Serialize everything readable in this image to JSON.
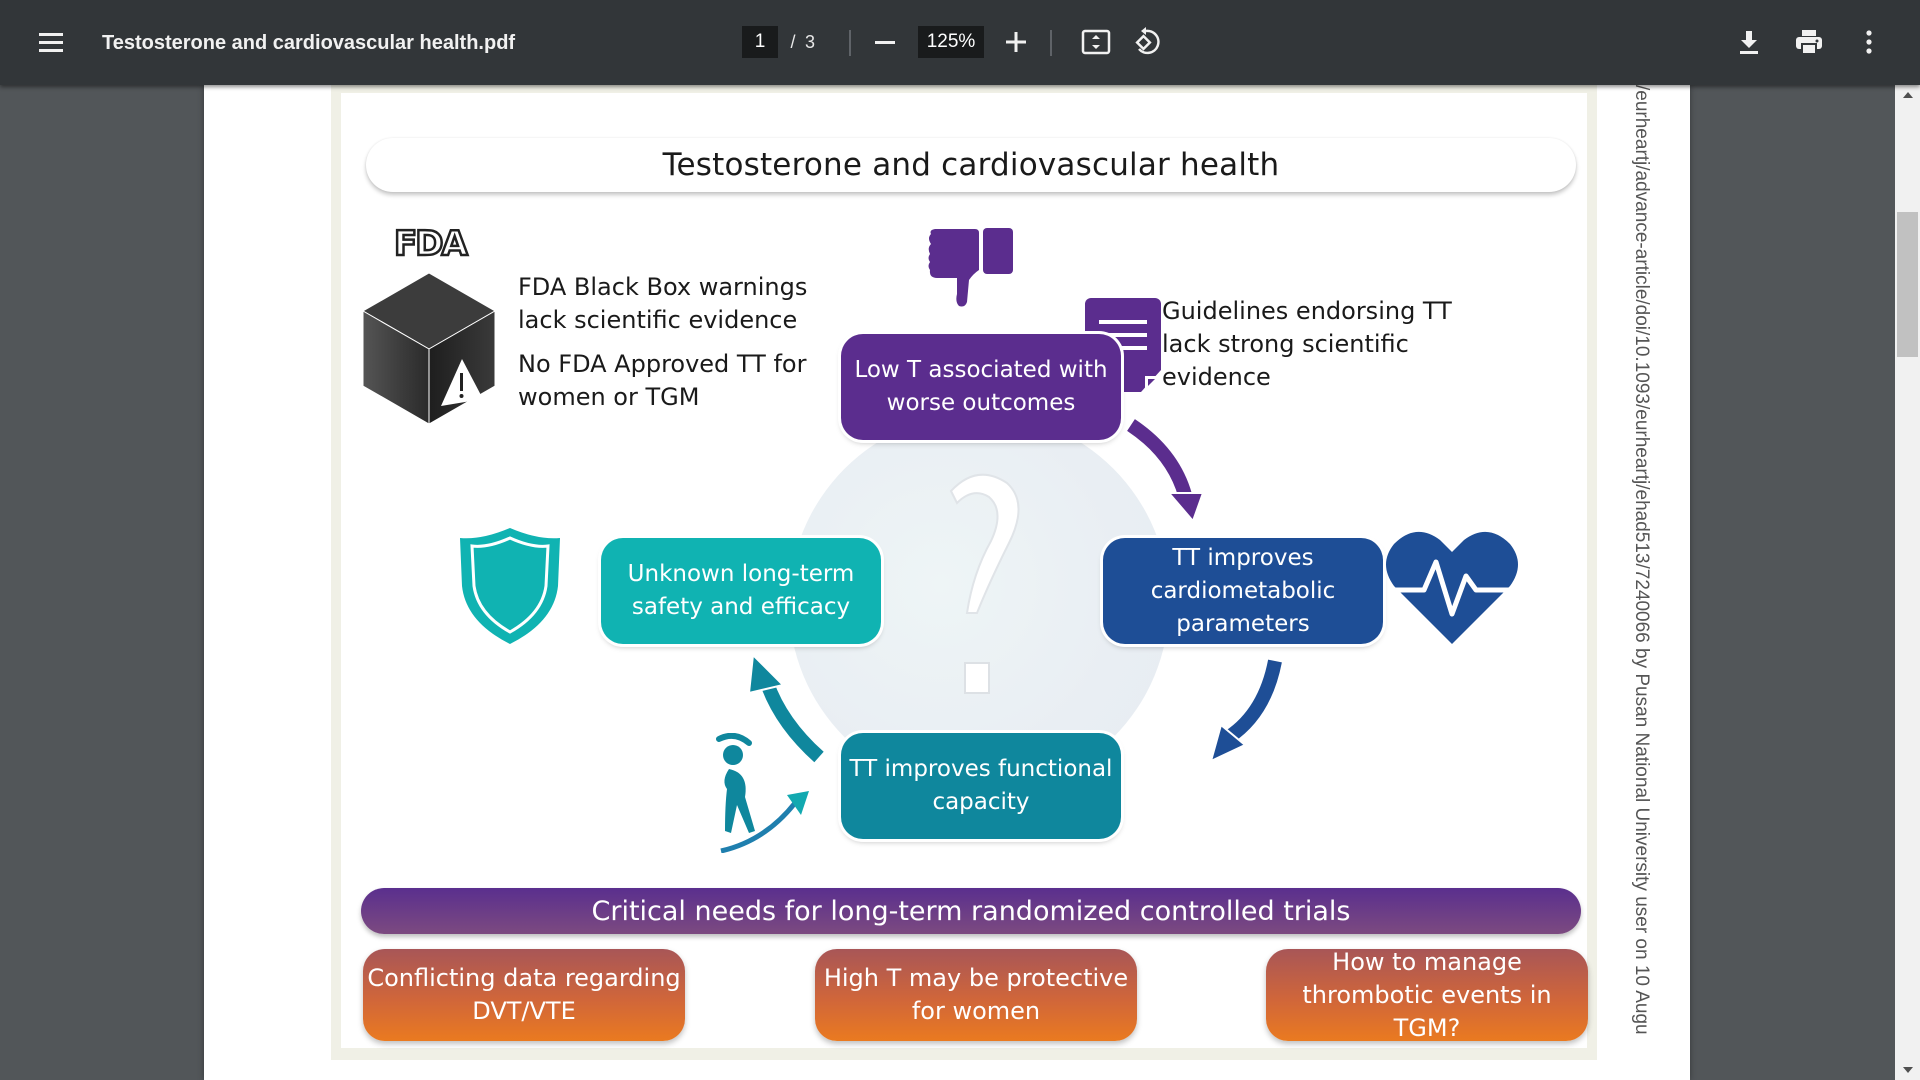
{
  "toolbar": {
    "title": "Testosterone and cardiovascular health.pdf",
    "current_page": "1",
    "page_separator": "/",
    "total_pages": "3",
    "zoom_level": "125%",
    "icons": {
      "menu": "hamburger-menu-icon",
      "zoom_out": "minus-icon",
      "zoom_in": "plus-icon",
      "fit": "fit-to-page-icon",
      "rotate": "rotate-counterclockwise-icon",
      "download": "download-icon",
      "print": "print-icon",
      "more": "more-vertical-icon"
    }
  },
  "infographic": {
    "title": "Testosterone and cardiovascular health",
    "fda_logo": "FDA",
    "fda_warning": "FDA Black Box warnings lack scientific evidence",
    "fda_no_approved": "No FDA Approved TT for women or TGM",
    "guidelines": "Guidelines endorsing TT lack strong scientific evidence",
    "cycle": {
      "low_t": "Low T associated with worse outcomes",
      "cardiometabolic": "TT improves cardiometabolic parameters",
      "functional": "TT improves functional capacity",
      "unknown": "Unknown long-term safety and efficacy",
      "center_symbol": "?"
    },
    "rct_banner": "Critical needs for long-term randomized controlled trials",
    "needs": [
      "Conflicting data regarding DVT/VTE",
      "High T may be protective for women",
      "How to manage thrombotic events in TGM?"
    ],
    "colors": {
      "purple": "#5b2d8e",
      "navy": "#1e4e96",
      "teal_dark": "#0f879d",
      "teal_light": "#10b3b2",
      "orange": "#ea7a20"
    }
  },
  "watermark": "/eurheartj/advance-article/doi/10.1093/eurheartj/ehad513/7240066 by Pusan National University user on 10 Augu"
}
